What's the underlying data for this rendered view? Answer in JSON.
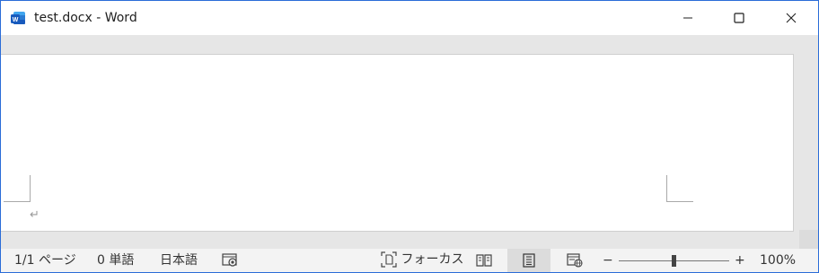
{
  "window": {
    "title": "test.docx - Word",
    "app_icon": "word-icon",
    "controls": [
      "minimize-icon",
      "maximize-icon",
      "close-icon"
    ]
  },
  "document": {
    "paragraph_mark": "↵"
  },
  "status_bar": {
    "page_info": "1/1 ページ",
    "word_count": "0 単語",
    "language": "日本語",
    "accessibility_icon": "accessibility-icon",
    "focus_label": "フォーカス",
    "views": [
      {
        "name": "read-mode",
        "icon": "read-mode-icon",
        "active": false
      },
      {
        "name": "print-layout",
        "icon": "print-layout-icon",
        "active": true
      },
      {
        "name": "web-layout",
        "icon": "web-layout-icon",
        "active": false
      }
    ],
    "zoom_minus": "−",
    "zoom_plus": "+",
    "zoom_level": "100%",
    "zoom_fraction": 0.5
  },
  "colors": {
    "accent": "#2b6cd8",
    "canvas_bg": "#e6e6e6",
    "status_bg": "#f3f3f3"
  }
}
